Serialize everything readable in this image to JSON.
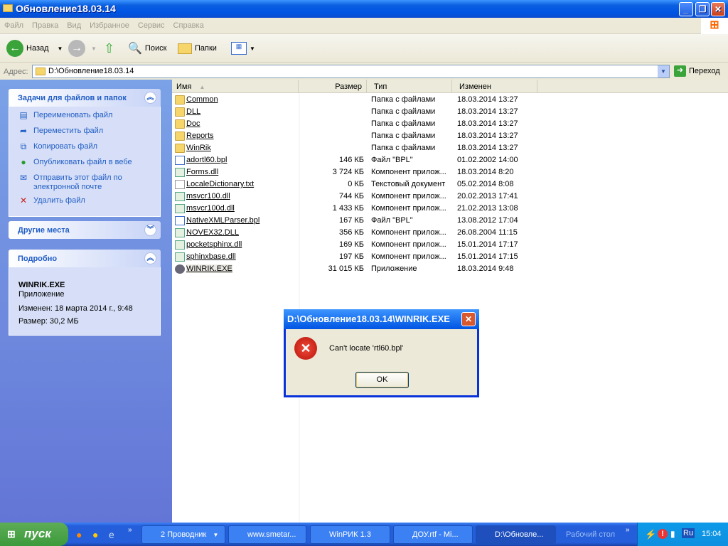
{
  "window": {
    "title": "Обновление18.03.14"
  },
  "menu": [
    "Файл",
    "Правка",
    "Вид",
    "Избранное",
    "Сервис",
    "Справка"
  ],
  "toolbar": {
    "back": "Назад",
    "search": "Поиск",
    "folders": "Папки"
  },
  "address": {
    "label": "Адрес:",
    "value": "D:\\Обновление18.03.14",
    "go": "Переход"
  },
  "tasks": {
    "title": "Задачи для файлов и папок",
    "items": [
      "Переименовать файл",
      "Переместить файл",
      "Копировать файл",
      "Опубликовать файл в вебе",
      "Отправить этот файл по электронной почте",
      "Удалить файл"
    ]
  },
  "places": {
    "title": "Другие места"
  },
  "details": {
    "title": "Подробно",
    "name": "WINRIK.EXE",
    "type": "Приложение",
    "modified": "Изменен: 18 марта 2014 г., 9:48",
    "size": "Размер: 30,2 МБ"
  },
  "columns": {
    "name": "Имя",
    "size": "Размер",
    "type": "Тип",
    "modified": "Изменен"
  },
  "files": [
    {
      "name": "Common",
      "size": "",
      "type": "Папка с файлами",
      "modified": "18.03.2014 13:27",
      "kind": "folder"
    },
    {
      "name": "DLL",
      "size": "",
      "type": "Папка с файлами",
      "modified": "18.03.2014 13:27",
      "kind": "folder"
    },
    {
      "name": "Doc",
      "size": "",
      "type": "Папка с файлами",
      "modified": "18.03.2014 13:27",
      "kind": "folder"
    },
    {
      "name": "Reports",
      "size": "",
      "type": "Папка с файлами",
      "modified": "18.03.2014 13:27",
      "kind": "folder"
    },
    {
      "name": "WinRik",
      "size": "",
      "type": "Папка с файлами",
      "modified": "18.03.2014 13:27",
      "kind": "folder"
    },
    {
      "name": "adortl60.bpl",
      "size": "146 КБ",
      "type": "Файл \"BPL\"",
      "modified": "01.02.2002 14:00",
      "kind": "bpl"
    },
    {
      "name": "Forms.dll",
      "size": "3 724 КБ",
      "type": "Компонент прилож...",
      "modified": "18.03.2014 8:20",
      "kind": "dll"
    },
    {
      "name": "LocaleDictionary.txt",
      "size": "0 КБ",
      "type": "Текстовый документ",
      "modified": "05.02.2014 8:08",
      "kind": "txt"
    },
    {
      "name": "msvcr100.dll",
      "size": "744 КБ",
      "type": "Компонент прилож...",
      "modified": "20.02.2013 17:41",
      "kind": "dll"
    },
    {
      "name": "msvcr100d.dll",
      "size": "1 433 КБ",
      "type": "Компонент прилож...",
      "modified": "21.02.2013 13:08",
      "kind": "dll"
    },
    {
      "name": "NativeXMLParser.bpl",
      "size": "167 КБ",
      "type": "Файл \"BPL\"",
      "modified": "13.08.2012 17:04",
      "kind": "bpl"
    },
    {
      "name": "NOVEX32.DLL",
      "size": "356 КБ",
      "type": "Компонент прилож...",
      "modified": "26.08.2004 11:15",
      "kind": "dll"
    },
    {
      "name": "pocketsphinx.dll",
      "size": "169 КБ",
      "type": "Компонент прилож...",
      "modified": "15.01.2014 17:17",
      "kind": "dll"
    },
    {
      "name": "sphinxbase.dll",
      "size": "197 КБ",
      "type": "Компонент прилож...",
      "modified": "15.01.2014 17:15",
      "kind": "dll"
    },
    {
      "name": "WINRIK.EXE",
      "size": "31 015 КБ",
      "type": "Приложение",
      "modified": "18.03.2014 9:48",
      "kind": "exe"
    }
  ],
  "dialog": {
    "title": "D:\\Обновление18.03.14\\WINRIK.EXE",
    "message": "Can't locate 'rtl60.bpl'",
    "ok": "OK"
  },
  "taskbar": {
    "start": "пуск",
    "items": [
      "2 Проводник",
      "www.smetar...",
      "WinРИК 1.3",
      "ДОУ.rtf - Mi...",
      "D:\\Обновле..."
    ],
    "desktop": "Рабочий стол",
    "lang": "Ru",
    "clock": "15:04"
  }
}
